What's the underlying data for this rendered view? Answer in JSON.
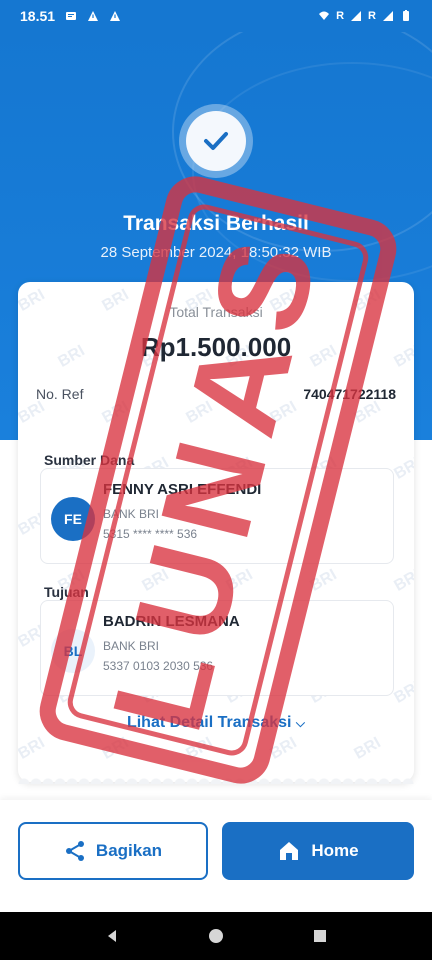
{
  "status_bar": {
    "time": "18.51",
    "signal_labels": [
      "R",
      "R"
    ]
  },
  "header": {
    "title": "Transaksi Berhasil",
    "datetime": "28 September 2024, 18:50:32 WIB"
  },
  "receipt": {
    "total_label": "Total Transaksi",
    "total_amount": "Rp1.500.000",
    "ref_label": "No. Ref",
    "ref_value": "740471722118",
    "watermark": "BRI",
    "source": {
      "section_label": "Sumber Dana",
      "initials": "FE",
      "name": "FENNY ASRI EFFENDI",
      "bank": "BANK BRI",
      "account": "5315 **** **** 536"
    },
    "destination": {
      "section_label": "Tujuan",
      "initials": "BL",
      "name": "BADRIN LESMANA",
      "bank": "BANK BRI",
      "account": "5337 0103 2030 536"
    },
    "detail_link": "Lihat Detail Transaksi"
  },
  "stamp": {
    "text": "LUNAS",
    "color": "#d9333f"
  },
  "actions": {
    "share_label": "Bagikan",
    "home_label": "Home"
  },
  "colors": {
    "brand_blue": "#1577d1",
    "button_blue": "#1a6fc4"
  }
}
